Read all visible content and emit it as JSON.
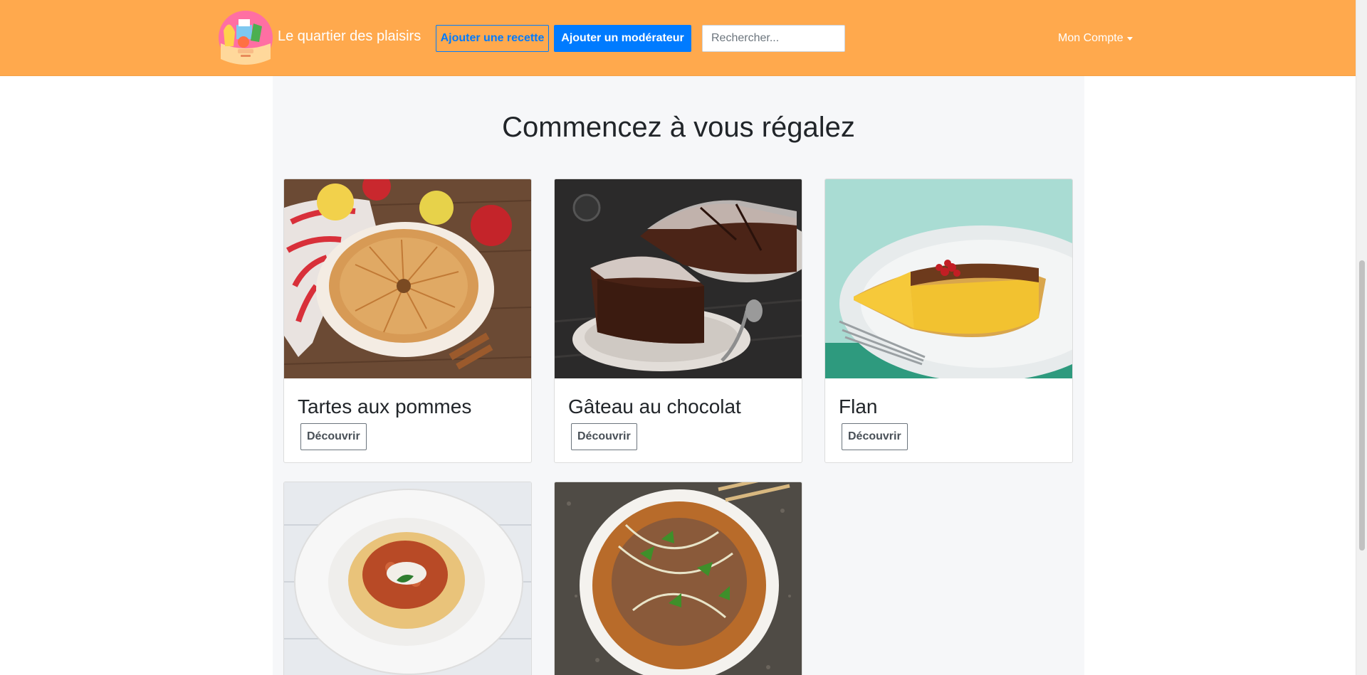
{
  "header": {
    "brand_name": "Le quartier des plaisirs",
    "add_recipe_label": "Ajouter une recette",
    "add_moderator_label": "Ajouter un modérateur",
    "search_placeholder": "Rechercher...",
    "account_label": "Mon Compte"
  },
  "main": {
    "title": "Commencez à vous régalez",
    "cards": [
      {
        "title": "Tartes aux pommes",
        "button_label": "Découvrir",
        "image": "apple-tart-image"
      },
      {
        "title": "Gâteau au chocolat",
        "button_label": "Découvrir",
        "image": "chocolate-cake-image"
      },
      {
        "title": "Flan",
        "button_label": "Découvrir",
        "image": "flan-image"
      },
      {
        "title": "",
        "button_label": "",
        "image": "spaghetti-bolognese-image"
      },
      {
        "title": "",
        "button_label": "",
        "image": "pho-soup-image"
      }
    ]
  },
  "colors": {
    "navbar": "#ffa94d",
    "primary": "#007bff",
    "container_bg": "#f6f7f9"
  }
}
